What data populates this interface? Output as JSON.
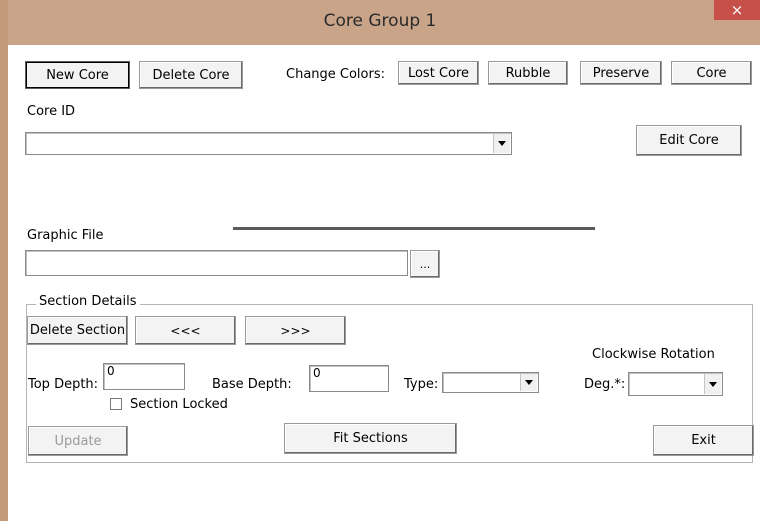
{
  "window": {
    "title": "Core Group 1",
    "close_symbol": "×"
  },
  "toolbar": {
    "new_core_label": "New Core",
    "delete_core_label": "Delete Core",
    "change_colors_label": "Change Colors:",
    "lost_core_label": "Lost Core",
    "rubble_label": "Rubble",
    "preserve_label": "Preserve",
    "core_label": "Core"
  },
  "core": {
    "core_id_label": "Core ID",
    "core_id_value": "",
    "edit_core_label": "Edit Core"
  },
  "graphic": {
    "graphic_file_label": "Graphic File",
    "graphic_file_value": "",
    "browse_label": "..."
  },
  "section": {
    "group_title": "Section Details",
    "delete_section_label": "Delete Section",
    "prev_label": "<<<",
    "next_label": ">>>",
    "top_depth_label": "Top Depth:",
    "top_depth_value": "0",
    "base_depth_label": "Base Depth:",
    "base_depth_value": "0",
    "type_label": "Type:",
    "type_value": "",
    "rotation_title": "Clockwise Rotation",
    "deg_label": "Deg.*:",
    "deg_value": "",
    "section_locked_label": "Section Locked",
    "section_locked_checked": false,
    "update_label": "Update",
    "fit_sections_label": "Fit Sections",
    "exit_label": "Exit"
  }
}
